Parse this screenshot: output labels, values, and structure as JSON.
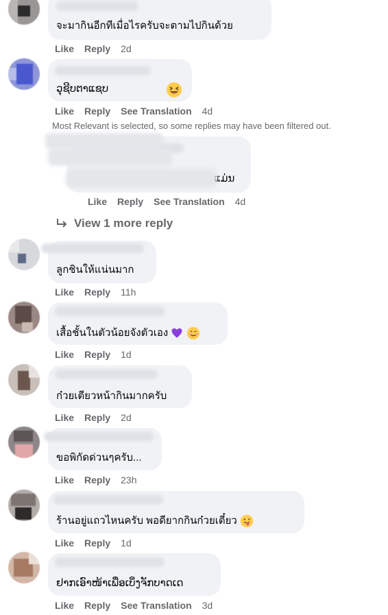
{
  "comments": [
    {
      "text": "จะมากินอีกทีเมื่อไรครับจะตามไปกินด้วย",
      "like": "Like",
      "reply": "Reply",
      "time": "2d"
    },
    {
      "text": "ວຸຊີບຕາແຊບ",
      "like": "Like",
      "reply": "Reply",
      "translate": "See Translation",
      "time": "4d"
    },
    {
      "text": "ແມ່ນ",
      "like": "Like",
      "reply": "Reply",
      "translate": "See Translation",
      "time": "4d"
    },
    {
      "text": "ลูกชินให้แน่นมาก",
      "like": "Like",
      "reply": "Reply",
      "time": "11h"
    },
    {
      "text": "เสื้อชั้นในตัวน้อยจังตัวเอง",
      "like": "Like",
      "reply": "Reply",
      "time": "1d"
    },
    {
      "text": "ก๋วยเตียวหน้ากินมากครับ",
      "like": "Like",
      "reply": "Reply",
      "time": "2d"
    },
    {
      "text": "ขอพิกัดด่วนๆครับ...",
      "like": "Like",
      "reply": "Reply",
      "time": "23h"
    },
    {
      "text": "ร้านอยู่แถวไหนครับ พอดียากกินก๋วยเตี๋ยว",
      "like": "Like",
      "reply": "Reply",
      "time": "1d"
    },
    {
      "text": "ຢາກເອົາໜ້າເພື່ອເບິ່ງຈັກບາດເດ",
      "like": "Like",
      "reply": "Reply",
      "translate": "See Translation",
      "time": "3d"
    }
  ],
  "notice": "Most Relevant is selected, so some replies may have been filtered out.",
  "view_more": "View 1 more reply",
  "colors": {
    "bubble": "#f0f2f5",
    "meta": "#65676b",
    "text": "#050505"
  }
}
